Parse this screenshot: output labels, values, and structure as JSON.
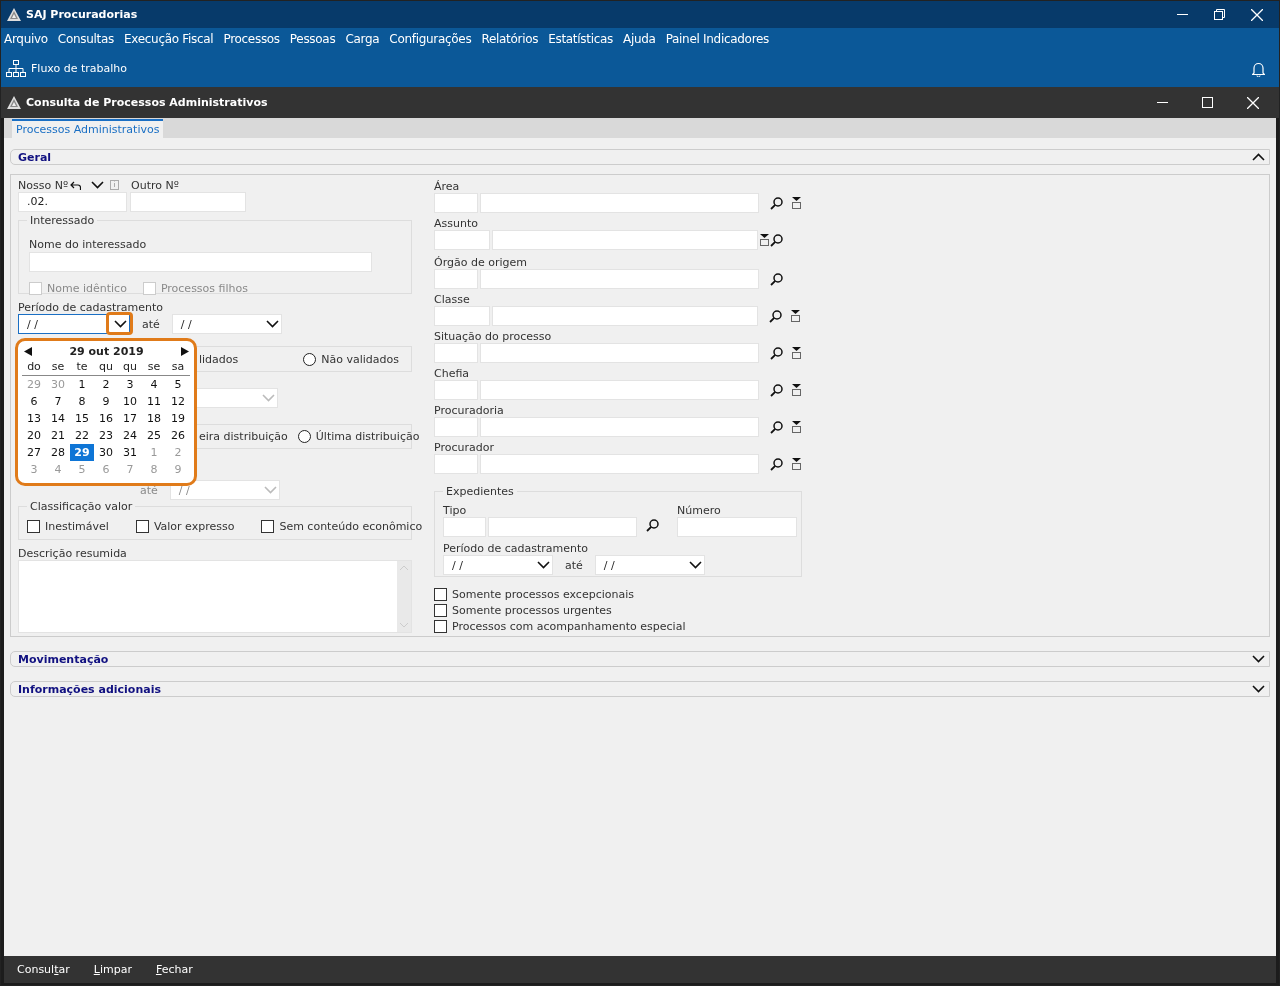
{
  "app_window": {
    "title": "SAJ Procuradorias"
  },
  "menu": [
    "Arquivo",
    "Consultas",
    "Execução Fiscal",
    "Processos",
    "Pessoas",
    "Carga",
    "Configurações",
    "Relatórios",
    "Estatísticas",
    "Ajuda",
    "Painel Indicadores"
  ],
  "toolbar": [
    {
      "label": "Fluxo de trabalho"
    }
  ],
  "form_window": {
    "title": "Consulta de Processos Administrativos"
  },
  "tabs": [
    {
      "label": "Processos Administrativos",
      "selected": true
    }
  ],
  "sections": [
    {
      "title": "Geral",
      "expanded": true
    },
    {
      "title": "Movimentação",
      "expanded": false
    },
    {
      "title": "Informações adicionais",
      "expanded": false
    }
  ],
  "geral": {
    "nosso_numero": {
      "label": "Nosso Nº",
      "value": ".02."
    },
    "outro_numero": {
      "label": "Outro Nº"
    },
    "interessado": {
      "title": "Interessado",
      "name_label": "Nome do interessado",
      "options": [
        {
          "label": "Nome idêntico",
          "checked": false,
          "disabled": true
        },
        {
          "label": "Processos filhos",
          "checked": false,
          "disabled": true
        }
      ]
    },
    "periodo": {
      "label": "Período de cadastramento",
      "from": "/ /",
      "between": "até",
      "to": "/ /",
      "highlighted": true
    },
    "covered_rows": [
      {
        "kind": "radio-group",
        "partial_text": "lidados",
        "option": {
          "label": "Não validados",
          "selected": false
        }
      },
      {
        "kind": "select",
        "disabled": true
      },
      {
        "kind": "radio-group",
        "partial_text": "eira distribuição",
        "option": {
          "label": "Última distribuição",
          "selected": false
        }
      },
      {
        "kind": "period",
        "disabled": true,
        "between": "até",
        "to": "/ /"
      }
    ],
    "classificacao": {
      "title": "Classificação valor",
      "options": [
        {
          "label": "Inestimável",
          "checked": false
        },
        {
          "label": "Valor expresso",
          "checked": false
        },
        {
          "label": "Sem conteúdo econômico",
          "checked": false
        }
      ]
    },
    "descricao": {
      "label": "Descrição resumida"
    }
  },
  "calendar": {
    "title": "29 out 2019",
    "highlighted": true,
    "weekdays": [
      "do",
      "se",
      "te",
      "qu",
      "qu",
      "se",
      "sa"
    ],
    "weeks": [
      [
        {
          "day": "29",
          "outside": true,
          "selected": false
        },
        {
          "day": "30",
          "outside": true,
          "selected": false
        },
        {
          "day": "1",
          "outside": false,
          "selected": false
        },
        {
          "day": "2",
          "outside": false,
          "selected": false
        },
        {
          "day": "3",
          "outside": false,
          "selected": false
        },
        {
          "day": "4",
          "outside": false,
          "selected": false
        },
        {
          "day": "5",
          "outside": false,
          "selected": false
        }
      ],
      [
        {
          "day": "6",
          "outside": false,
          "selected": false
        },
        {
          "day": "7",
          "outside": false,
          "selected": false
        },
        {
          "day": "8",
          "outside": false,
          "selected": false
        },
        {
          "day": "9",
          "outside": false,
          "selected": false
        },
        {
          "day": "10",
          "outside": false,
          "selected": false
        },
        {
          "day": "11",
          "outside": false,
          "selected": false
        },
        {
          "day": "12",
          "outside": false,
          "selected": false
        }
      ],
      [
        {
          "day": "13",
          "outside": false,
          "selected": false
        },
        {
          "day": "14",
          "outside": false,
          "selected": false
        },
        {
          "day": "15",
          "outside": false,
          "selected": false
        },
        {
          "day": "16",
          "outside": false,
          "selected": false
        },
        {
          "day": "17",
          "outside": false,
          "selected": false
        },
        {
          "day": "18",
          "outside": false,
          "selected": false
        },
        {
          "day": "19",
          "outside": false,
          "selected": false
        }
      ],
      [
        {
          "day": "20",
          "outside": false,
          "selected": false
        },
        {
          "day": "21",
          "outside": false,
          "selected": false
        },
        {
          "day": "22",
          "outside": false,
          "selected": false
        },
        {
          "day": "23",
          "outside": false,
          "selected": false
        },
        {
          "day": "24",
          "outside": false,
          "selected": false
        },
        {
          "day": "25",
          "outside": false,
          "selected": false
        },
        {
          "day": "26",
          "outside": false,
          "selected": false
        }
      ],
      [
        {
          "day": "27",
          "outside": false,
          "selected": false
        },
        {
          "day": "28",
          "outside": false,
          "selected": false
        },
        {
          "day": "29",
          "outside": false,
          "selected": true
        },
        {
          "day": "30",
          "outside": false,
          "selected": false
        },
        {
          "day": "31",
          "outside": false,
          "selected": false
        },
        {
          "day": "1",
          "outside": true,
          "selected": false
        },
        {
          "day": "2",
          "outside": true,
          "selected": false
        }
      ],
      [
        {
          "day": "3",
          "outside": true,
          "selected": false
        },
        {
          "day": "4",
          "outside": true,
          "selected": false
        },
        {
          "day": "5",
          "outside": true,
          "selected": false
        },
        {
          "day": "6",
          "outside": true,
          "selected": false
        },
        {
          "day": "7",
          "outside": true,
          "selected": false
        },
        {
          "day": "8",
          "outside": true,
          "selected": false
        },
        {
          "day": "9",
          "outside": true,
          "selected": false
        }
      ]
    ]
  },
  "lookups": [
    {
      "label": "Área",
      "kind": "search-menu",
      "wide_code": false
    },
    {
      "label": "Assunto",
      "kind": "menu-search",
      "wide_code": true
    },
    {
      "label": "Órgão de origem",
      "kind": "search",
      "wide_code": false
    },
    {
      "label": "Classe",
      "kind": "search-menu",
      "wide_code": true
    },
    {
      "label": "Situação do processo",
      "kind": "search-menu",
      "wide_code": false
    },
    {
      "label": "Chefia",
      "kind": "search-menu",
      "wide_code": false
    },
    {
      "label": "Procuradoria",
      "kind": "search-menu",
      "wide_code": false
    },
    {
      "label": "Procurador",
      "kind": "search-menu",
      "wide_code": false
    }
  ],
  "expedientes": {
    "title": "Expedientes",
    "tipo_label": "Tipo",
    "numero_label": "Número",
    "periodo_label": "Período de cadastramento",
    "from": "/ /",
    "between": "até",
    "to": "/ /"
  },
  "flags": [
    {
      "label": "Somente processos excepcionais",
      "checked": false
    },
    {
      "label": "Somente processos urgentes",
      "checked": false
    },
    {
      "label": "Processos com acompanhamento especial",
      "checked": false
    }
  ],
  "actions": [
    {
      "before_key": "Consul",
      "access_key": "t",
      "after_key": "ar"
    },
    {
      "access_key": "L",
      "after_key": "impar"
    },
    {
      "access_key": "F",
      "after_key": "echar"
    }
  ]
}
